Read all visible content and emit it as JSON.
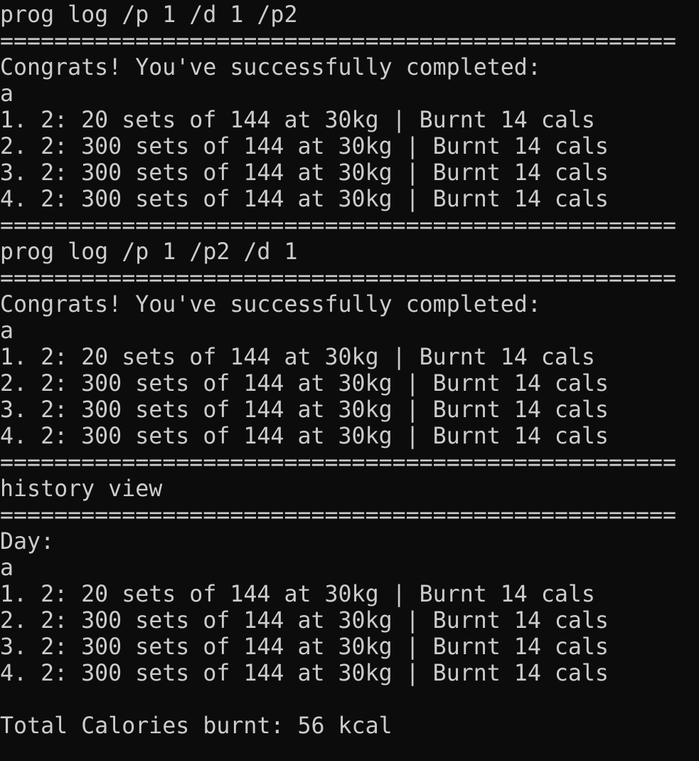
{
  "colors": {
    "background": "#0c0c0c",
    "foreground": "#cccccc"
  },
  "terminal": {
    "lines": [
      "prog log /p 1 /d 1 /p2",
      "==================================================",
      "Congrats! You've successfully completed:",
      "a",
      "1. 2: 20 sets of 144 at 30kg | Burnt 14 cals",
      "2. 2: 300 sets of 144 at 30kg | Burnt 14 cals",
      "3. 2: 300 sets of 144 at 30kg | Burnt 14 cals",
      "4. 2: 300 sets of 144 at 30kg | Burnt 14 cals",
      "==================================================",
      "prog log /p 1 /p2 /d 1",
      "==================================================",
      "Congrats! You've successfully completed:",
      "a",
      "1. 2: 20 sets of 144 at 30kg | Burnt 14 cals",
      "2. 2: 300 sets of 144 at 30kg | Burnt 14 cals",
      "3. 2: 300 sets of 144 at 30kg | Burnt 14 cals",
      "4. 2: 300 sets of 144 at 30kg | Burnt 14 cals",
      "==================================================",
      "history view",
      "==================================================",
      "Day:",
      "a",
      "1. 2: 20 sets of 144 at 30kg | Burnt 14 cals",
      "2. 2: 300 sets of 144 at 30kg | Burnt 14 cals",
      "3. 2: 300 sets of 144 at 30kg | Burnt 14 cals",
      "4. 2: 300 sets of 144 at 30kg | Burnt 14 cals",
      "",
      "Total Calories burnt: 56 kcal"
    ]
  }
}
